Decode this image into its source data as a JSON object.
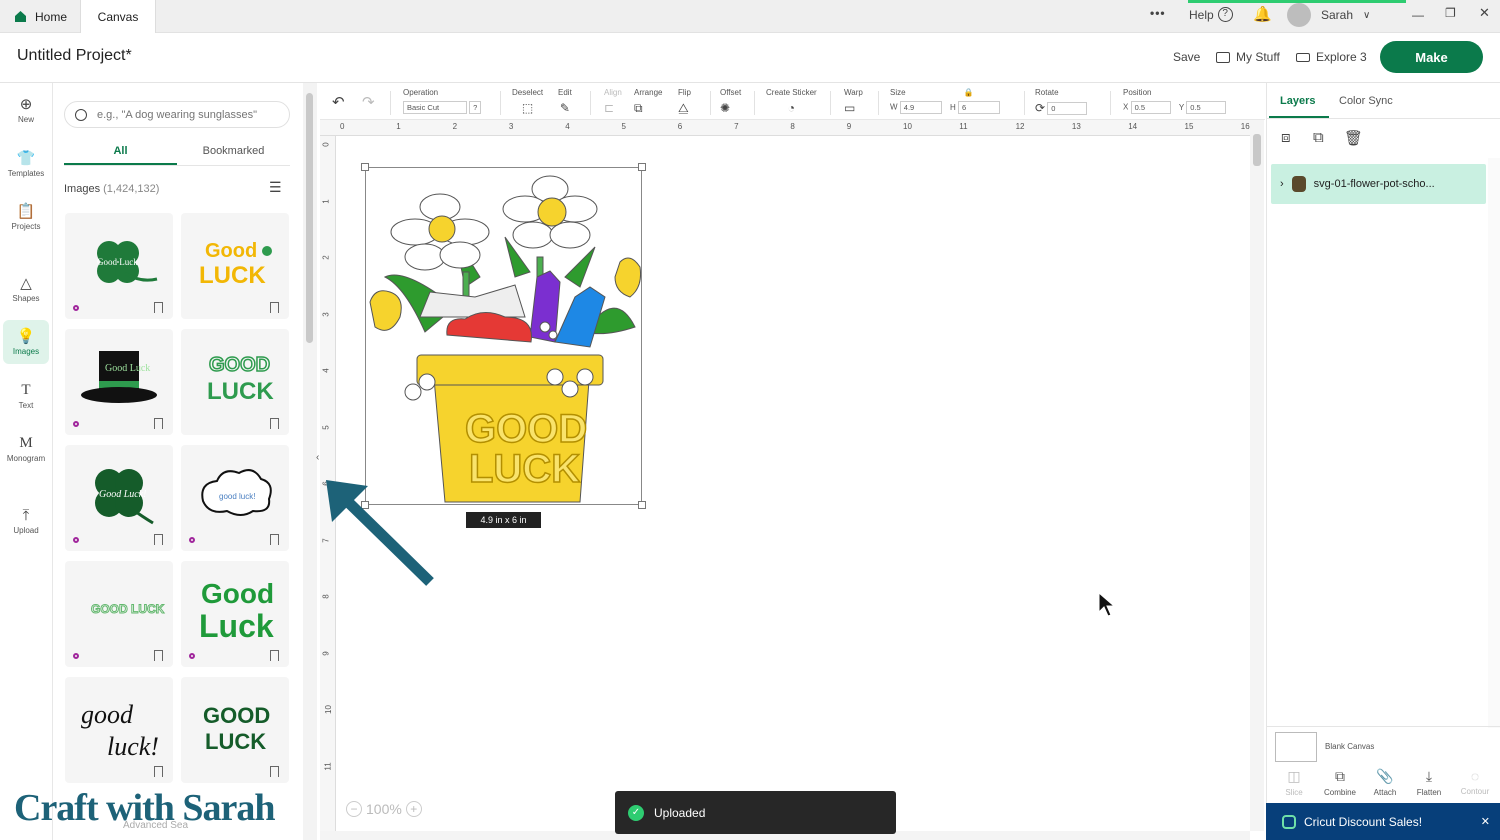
{
  "topbar": {
    "home": "Home",
    "canvas": "Canvas",
    "more": "•••",
    "help": "Help",
    "user": "Sarah"
  },
  "header": {
    "title": "Untitled Project*",
    "save": "Save",
    "my_stuff": "My Stuff",
    "machine": "Explore 3",
    "make": "Make"
  },
  "rail": {
    "new": "New",
    "templates": "Templates",
    "projects": "Projects",
    "shapes": "Shapes",
    "images": "Images",
    "text": "Text",
    "monogram": "Monogram",
    "upload": "Upload"
  },
  "panel": {
    "search_placeholder": "e.g., \"A dog wearing sunglasses\"",
    "tab_all": "All",
    "tab_bookmarked": "Bookmarked",
    "images_label": "Images",
    "images_count": "(1,424,132)"
  },
  "toolbar": {
    "operation_label": "Operation",
    "operation_value": "Basic Cut",
    "deselect": "Deselect",
    "edit": "Edit",
    "align": "Align",
    "arrange": "Arrange",
    "flip": "Flip",
    "offset": "Offset",
    "create_sticker": "Create Sticker",
    "warp": "Warp",
    "size": "Size",
    "w_label": "W",
    "w_value": "4.9",
    "h_label": "H",
    "h_value": "6",
    "rotate": "Rotate",
    "rotate_value": "0",
    "position": "Position",
    "x_label": "X",
    "x_value": "0.5",
    "y_label": "Y",
    "y_value": "0.5"
  },
  "ruler": {
    "top": [
      "0",
      "1",
      "2",
      "3",
      "4",
      "5",
      "6",
      "7",
      "8",
      "9",
      "10",
      "11",
      "12",
      "13",
      "14",
      "15",
      "16"
    ],
    "left": [
      "0",
      "1",
      "2",
      "3",
      "4",
      "5",
      "6",
      "7",
      "8",
      "9",
      "10",
      "11"
    ]
  },
  "canvas": {
    "size_tip": "4.9  in x 6  in",
    "zoom": "100%",
    "toast": "Uploaded"
  },
  "right": {
    "tab_layers": "Layers",
    "tab_color_sync": "Color Sync",
    "layer_name": "svg-01-flower-pot-scho...",
    "blank_canvas": "Blank Canvas",
    "slice": "Slice",
    "combine": "Combine",
    "attach": "Attach",
    "flatten": "Flatten",
    "contour": "Contour",
    "promo": "Cricut Discount Sales!"
  },
  "colors": {
    "brand": "#0b7a4b",
    "layer_highlight": "#c9f0e1",
    "promo": "#073f7a",
    "watermark": "#1d6278"
  },
  "watermark": {
    "text": "Craft with Sarah",
    "sub": "Advanced Sea"
  }
}
